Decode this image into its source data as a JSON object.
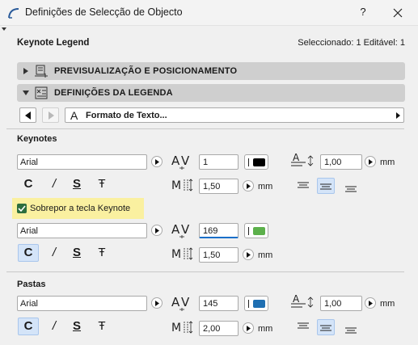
{
  "window": {
    "title": "Definições de Selecção de Objecto",
    "help_label": "?"
  },
  "header": {
    "title": "Keynote Legend",
    "selection": "Seleccionado: 1 Editável: 1"
  },
  "panels": [
    {
      "label": "PREVISUALIZAÇÃO E POSICIONAMENTO",
      "expanded": false
    },
    {
      "label": "DEFINIÇÕES DA LEGENDA",
      "expanded": true
    }
  ],
  "page_selector": {
    "label": "Formato de Texto..."
  },
  "sections": {
    "keynotes": {
      "title": "Keynotes",
      "font": "Arial",
      "width_factor": "1",
      "pen_color": "#000000",
      "leading": "1,00",
      "leading_unit": "mm",
      "height": "1,50",
      "height_unit": "mm",
      "styles": [
        "C",
        "/",
        "S",
        "Ŧ"
      ],
      "active_align": 1
    },
    "override": {
      "checkbox_label": "Sobrepor a tecla Keynote",
      "checked": true,
      "font": "Arial",
      "width_factor": "169",
      "pen_color": "#5cb04b",
      "height": "1,50",
      "height_unit": "mm",
      "styles": [
        "C",
        "/",
        "S",
        "Ŧ"
      ],
      "active_style": 0
    },
    "pastas": {
      "title": "Pastas",
      "font": "Arial",
      "width_factor": "145",
      "pen_color": "#1f6fb2",
      "leading": "1,00",
      "leading_unit": "mm",
      "height": "2,00",
      "height_unit": "mm",
      "styles": [
        "C",
        "/",
        "S",
        "Ŧ"
      ],
      "active_style": 0,
      "active_align": 1
    }
  },
  "colors": {
    "accent": "#1a6fc9",
    "active_bg": "#d4e4f8",
    "highlight": "#faf0a0"
  }
}
